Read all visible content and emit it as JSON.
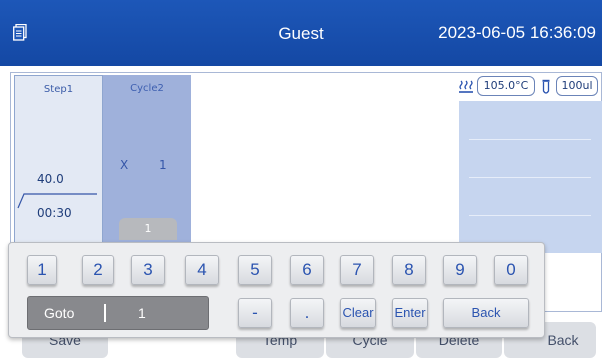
{
  "header": {
    "user": "Guest",
    "datetime": "2023-06-05 16:36:09"
  },
  "steps": [
    {
      "title": "Step1",
      "temp": "40.0",
      "time": "00:30"
    }
  ],
  "cycle": {
    "title": "Cycle2",
    "multiplier": "X",
    "count": "1",
    "badge": "1"
  },
  "status": {
    "lid_temp": "105.0°C",
    "volume": "100ul"
  },
  "bottom_bar": {
    "save": "Save",
    "temp": "Temp",
    "cycle": "Cycle",
    "delete": "Delete",
    "back": "Back"
  },
  "keypad": {
    "digits": [
      "1",
      "2",
      "3",
      "4",
      "5",
      "6",
      "7",
      "8",
      "9",
      "0"
    ],
    "goto_label": "Goto",
    "goto_value": "1",
    "minus": "-",
    "dot": ".",
    "clear": "Clear",
    "enter": "Enter",
    "back": "Back"
  },
  "colors": {
    "header": "#1d57b8",
    "step_bg": "#e3e9f4",
    "cycle_bg": "#9fb1db",
    "key_text": "#2b54b0"
  },
  "icons": {
    "header": "document-list-icon",
    "lid": "heater-icon",
    "tube": "tube-icon"
  }
}
